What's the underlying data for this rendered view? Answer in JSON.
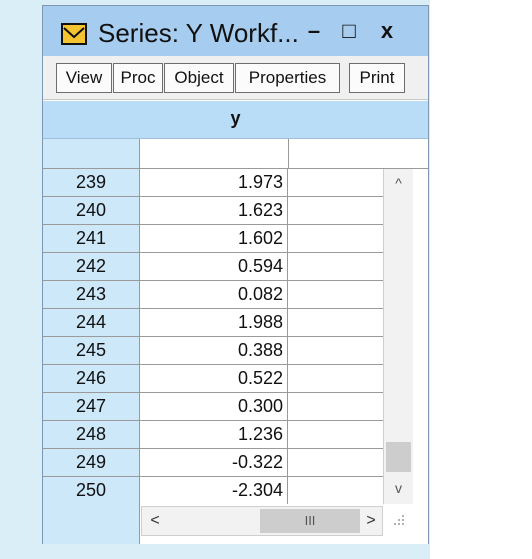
{
  "window": {
    "title": "Series: Y   Workf...",
    "minimize_glyph": "–",
    "maximize_glyph": "□",
    "close_glyph": "x",
    "icon": "series-window-icon"
  },
  "toolbar": {
    "buttons": [
      "View",
      "Proc",
      "Object",
      "Properties",
      "Print"
    ]
  },
  "column_header": "y",
  "rows": [
    {
      "obs": "239",
      "value": "1.973"
    },
    {
      "obs": "240",
      "value": "1.623"
    },
    {
      "obs": "241",
      "value": "1.602"
    },
    {
      "obs": "242",
      "value": "0.594"
    },
    {
      "obs": "243",
      "value": "0.082"
    },
    {
      "obs": "244",
      "value": "1.988"
    },
    {
      "obs": "245",
      "value": "0.388"
    },
    {
      "obs": "246",
      "value": "0.522"
    },
    {
      "obs": "247",
      "value": "0.300"
    },
    {
      "obs": "248",
      "value": "1.236"
    },
    {
      "obs": "249",
      "value": "-0.322"
    },
    {
      "obs": "250",
      "value": "-2.304"
    }
  ],
  "scrollbars": {
    "up": "^",
    "down": "v",
    "left": "<",
    "right": ">",
    "thumb_grip": "III"
  }
}
